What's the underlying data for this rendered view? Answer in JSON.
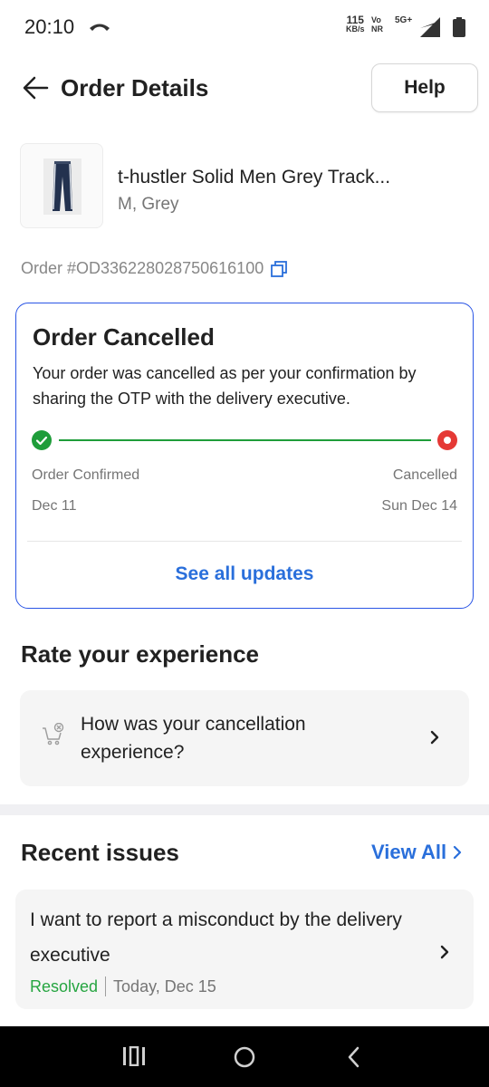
{
  "status_bar": {
    "time": "20:10",
    "net_speed_value": "115",
    "net_speed_unit": "KB/s",
    "volte_top": "Vo",
    "volte_bottom": "NR",
    "network": "5G+"
  },
  "header": {
    "title": "Order Details",
    "help_label": "Help"
  },
  "product": {
    "title": "t-hustler Solid Men Grey Track...",
    "variant": "M, Grey",
    "image_icon": "track-pants-thumbnail"
  },
  "order": {
    "id_text": "Order #OD336228028750616100"
  },
  "status_card": {
    "title": "Order Cancelled",
    "description": "Your order was cancelled as per your confirmation by sharing the OTP with the delivery executive.",
    "start_label": "Order Confirmed",
    "start_date": "Dec 11",
    "end_label": "Cancelled",
    "end_date": "Sun Dec 14",
    "see_updates_label": "See all updates"
  },
  "rate": {
    "heading": "Rate your experience",
    "question": "How was your cancellation experience?"
  },
  "recent_issues": {
    "heading": "Recent issues",
    "view_all_label": "View All",
    "items": [
      {
        "title": "I want to report a misconduct by the delivery executive",
        "status": "Resolved",
        "date": "Today, Dec 15"
      }
    ]
  },
  "colors": {
    "accent_blue": "#2a6fdb",
    "card_border": "#2a55e5",
    "success_green": "#1f9d3a",
    "cancel_red": "#e53935"
  }
}
